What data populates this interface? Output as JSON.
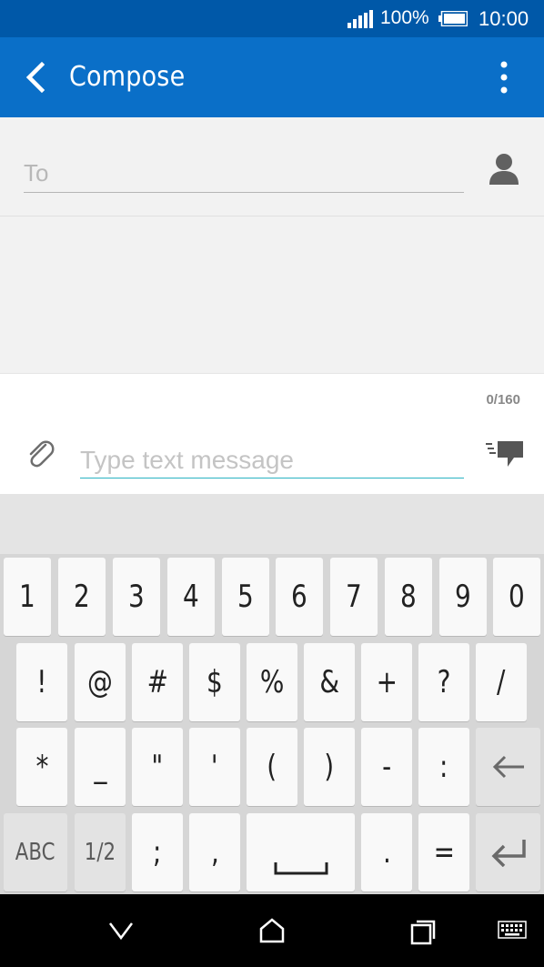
{
  "status_bar": {
    "battery_percent": "100%",
    "time": "10:00",
    "icons": [
      "signal-icon",
      "battery-icon"
    ]
  },
  "app_bar": {
    "title": "Compose",
    "back_icon": "chevron-left-icon",
    "menu_icon": "more-vert-icon"
  },
  "recipient": {
    "placeholder": "To",
    "value": "",
    "contact_icon": "person-icon"
  },
  "composer": {
    "char_count": "0/160",
    "placeholder": "Type text message",
    "value": "",
    "attach_icon": "paperclip-icon",
    "send_icon": "send-message-icon"
  },
  "keyboard": {
    "row1": [
      "1",
      "2",
      "3",
      "4",
      "5",
      "6",
      "7",
      "8",
      "9",
      "0"
    ],
    "row2": [
      "!",
      "@",
      "#",
      "$",
      "%",
      "&",
      "+",
      "?",
      "/"
    ],
    "row3": [
      "*",
      "_",
      "\"",
      "'",
      "(",
      ")",
      "-",
      ":"
    ],
    "row4": {
      "abc": "ABC",
      "page": "1/2",
      "semicolon": ";",
      "comma": ",",
      "period": ".",
      "equals": "="
    },
    "backspace_icon": "backspace-arrow-icon",
    "enter_icon": "enter-icon",
    "space_icon": "space-bar-icon"
  },
  "nav_bar": {
    "icons": [
      "back-icon",
      "home-icon",
      "recents-icon",
      "keyboard-icon"
    ]
  },
  "colors": {
    "status_bar": "#0058a8",
    "app_bar": "#0a6fc8",
    "accent": "#2ab2c2"
  }
}
